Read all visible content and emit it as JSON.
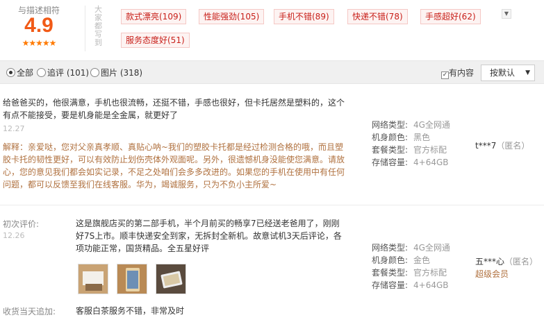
{
  "header": {
    "score_label": "与描述相符",
    "score_value": "4.9",
    "stars": "★★★★★",
    "vertical_label": "大家都写到",
    "tags": [
      "款式漂亮(109)",
      "性能强劲(105)",
      "手机不错(89)",
      "快递不错(78)",
      "手感超好(62)",
      "服务态度好(51)"
    ]
  },
  "filter": {
    "options": [
      "全部",
      "追评 (101)",
      "图片 (318)"
    ],
    "selected_index": 0,
    "content_check_label": "有内容",
    "content_checked": true,
    "sort_label": "按默认"
  },
  "reviews": [
    {
      "text": "给爸爸买的，他很满意，手机也很流畅，还挺不错，手感也很好，但卡托居然是塑料的，这个有点不能接受，要是机身能是全金属，就更好了",
      "date": "12.27",
      "reply": "解释：亲爱哒，您对父亲真孝顺、真贴心呐~我们的塑胶卡托都是经过检测合格的哦，而且塑胶卡托的韧性更好，可以有效防止划伤壳体外观面呢。另外，很遗憾机身没能使您满意。请放心，您的意见我们都会如实记录，不足之处咱们会多多改进的。如果您的手机在使用中有任何问题，都可以反馈至我们在线客服。华为，竭诚服务，只为不负小主所爱~",
      "specs": [
        {
          "k": "网络类型:",
          "v": "4G全网通"
        },
        {
          "k": "机身颜色:",
          "v": "黑色"
        },
        {
          "k": "套餐类型:",
          "v": "官方标配"
        },
        {
          "k": "存储容量:",
          "v": "4+64GB"
        }
      ],
      "user": "t***7",
      "anon": "（匿名）"
    },
    {
      "first_label": "初次评价:",
      "date": "12.26",
      "text": "这是旗舰店买的第二部手机，半个月前买的畅享7已经送老爸用了，刚刚好7S上市。顺丰快递安全到家，无拆封全新机。故意试机3天后评论，各项功能正常，国货精品。全五星好评",
      "specs": [
        {
          "k": "网络类型:",
          "v": "4G全网通"
        },
        {
          "k": "机身颜色:",
          "v": "金色"
        },
        {
          "k": "套餐类型:",
          "v": "官方标配"
        },
        {
          "k": "存储容量:",
          "v": "4+64GB"
        }
      ],
      "user": "五***心",
      "anon": "（匿名）",
      "vip": "超级会员",
      "append_label": "收货当天追加:",
      "append_text": "客服白茶服务不错，非常及时"
    }
  ]
}
